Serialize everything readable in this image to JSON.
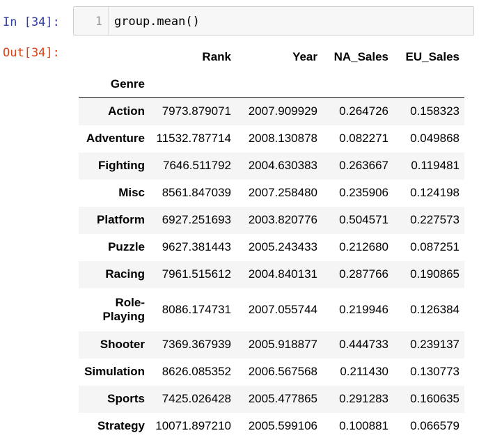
{
  "cell": {
    "in_prompt": "In [34]:",
    "out_prompt": "Out[34]:",
    "line_number": "1",
    "code": "group.mean()"
  },
  "table": {
    "columns": [
      "Rank",
      "Year",
      "NA_Sales",
      "EU_Sales"
    ],
    "index_name": "Genre",
    "rows": [
      {
        "genre": "Action",
        "rank": "7973.879071",
        "year": "2007.909929",
        "na_sales": "0.264726",
        "eu_sales": "0.158323"
      },
      {
        "genre": "Adventure",
        "rank": "11532.787714",
        "year": "2008.130878",
        "na_sales": "0.082271",
        "eu_sales": "0.049868"
      },
      {
        "genre": "Fighting",
        "rank": "7646.511792",
        "year": "2004.630383",
        "na_sales": "0.263667",
        "eu_sales": "0.119481"
      },
      {
        "genre": "Misc",
        "rank": "8561.847039",
        "year": "2007.258480",
        "na_sales": "0.235906",
        "eu_sales": "0.124198"
      },
      {
        "genre": "Platform",
        "rank": "6927.251693",
        "year": "2003.820776",
        "na_sales": "0.504571",
        "eu_sales": "0.227573"
      },
      {
        "genre": "Puzzle",
        "rank": "9627.381443",
        "year": "2005.243433",
        "na_sales": "0.212680",
        "eu_sales": "0.087251"
      },
      {
        "genre": "Racing",
        "rank": "7961.515612",
        "year": "2004.840131",
        "na_sales": "0.287766",
        "eu_sales": "0.190865"
      },
      {
        "genre_line1": "Role-",
        "genre_line2": "Playing",
        "rank": "8086.174731",
        "year": "2007.055744",
        "na_sales": "0.219946",
        "eu_sales": "0.126384"
      },
      {
        "genre": "Shooter",
        "rank": "7369.367939",
        "year": "2005.918877",
        "na_sales": "0.444733",
        "eu_sales": "0.239137"
      },
      {
        "genre": "Simulation",
        "rank": "8626.085352",
        "year": "2006.567568",
        "na_sales": "0.211430",
        "eu_sales": "0.130773"
      },
      {
        "genre": "Sports",
        "rank": "7425.026428",
        "year": "2005.477865",
        "na_sales": "0.291283",
        "eu_sales": "0.160635"
      },
      {
        "genre": "Strategy",
        "rank": "10071.897210",
        "year": "2005.599106",
        "na_sales": "0.100881",
        "eu_sales": "0.066579"
      }
    ]
  }
}
